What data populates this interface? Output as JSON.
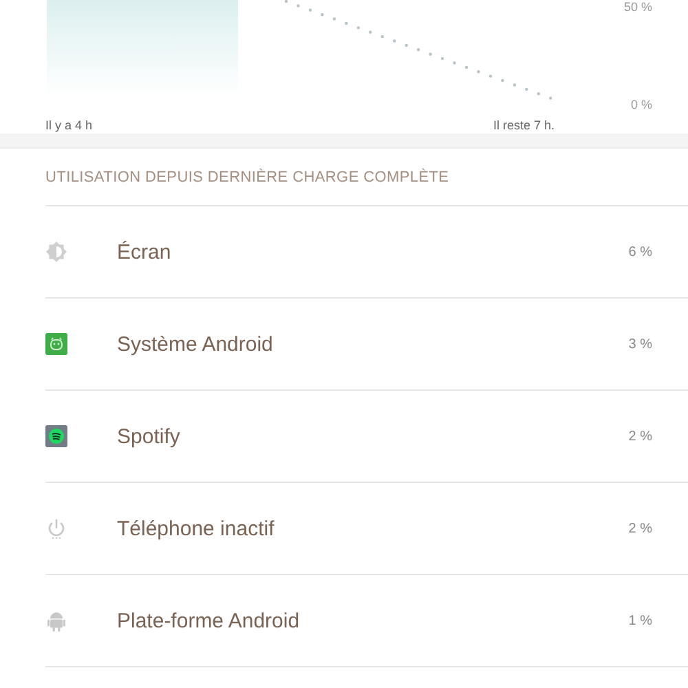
{
  "battery_chart": {
    "y_tick_labels": [
      "50 %",
      "0 %"
    ],
    "x_labels": [
      "Il y a 4 h",
      "Il reste 7 h."
    ]
  },
  "usage": {
    "header": "UTILISATION DEPUIS DERNIÈRE CHARGE COMPLÈTE",
    "items": [
      {
        "kind": "screen",
        "label": "Écran",
        "percent": "6 %"
      },
      {
        "kind": "android-system",
        "label": "Système Android",
        "percent": "3 %"
      },
      {
        "kind": "music-app",
        "label": "Spotify",
        "percent": "2 %"
      },
      {
        "kind": "idle",
        "label": "Téléphone inactif",
        "percent": "2 %"
      },
      {
        "kind": "android",
        "label": "Plate-forme Android",
        "percent": "1 %"
      }
    ]
  }
}
